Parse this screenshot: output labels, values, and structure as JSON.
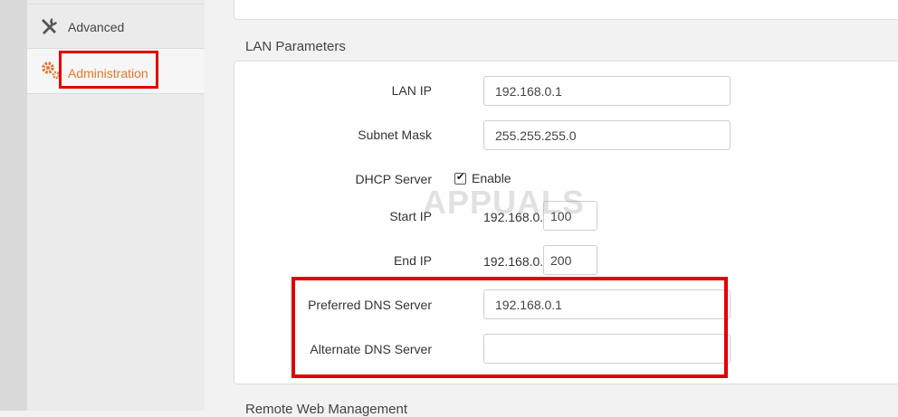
{
  "sidebar": {
    "items": [
      {
        "label": "Advanced",
        "icon": "tools-icon"
      },
      {
        "label": "Administration",
        "icon": "gears-icon",
        "active": true
      }
    ]
  },
  "lan": {
    "title": "LAN Parameters",
    "lan_ip_label": "LAN IP",
    "lan_ip_value": "192.168.0.1",
    "subnet_label": "Subnet Mask",
    "subnet_value": "255.255.255.0",
    "dhcp_label": "DHCP Server",
    "dhcp_enable_label": "Enable",
    "dhcp_enabled": true,
    "start_ip_label": "Start IP",
    "start_ip_prefix": "192.168.0.",
    "start_ip_value": "100",
    "end_ip_label": "End IP",
    "end_ip_prefix": "192.168.0.",
    "end_ip_value": "200",
    "pref_dns_label": "Preferred DNS Server",
    "pref_dns_value": "192.168.0.1",
    "alt_dns_label": "Alternate DNS Server",
    "alt_dns_value": ""
  },
  "next_section_title": "Remote Web Management",
  "watermark": "APPUALS",
  "colors": {
    "accent": "#e8772e",
    "highlight": "#e00000"
  }
}
